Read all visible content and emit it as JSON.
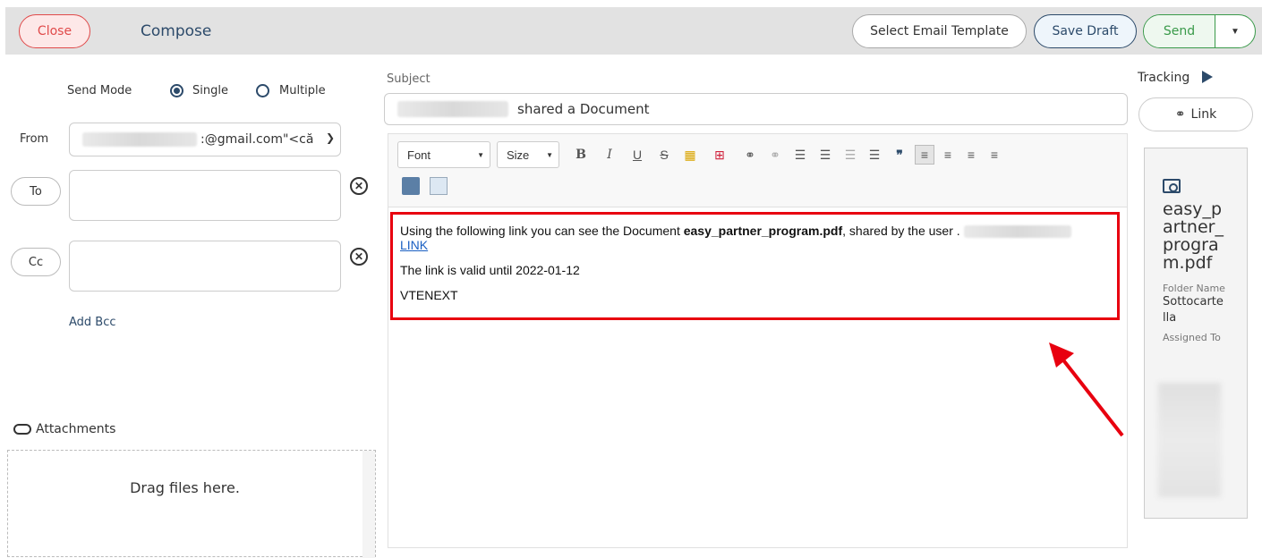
{
  "header": {
    "close_label": "Close",
    "title": "Compose",
    "select_template_label": "Select Email Template",
    "save_draft_label": "Save Draft",
    "send_label": "Send"
  },
  "form": {
    "send_mode_label": "Send Mode",
    "mode_single": "Single",
    "mode_multiple": "Multiple",
    "from_label": "From",
    "from_value": ":@gmail.com\"<că",
    "to_label": "To",
    "cc_label": "Cc",
    "add_bcc": "Add Bcc",
    "attachments_label": "Attachments",
    "drop_text": "Drag files here."
  },
  "subject": {
    "label": "Subject",
    "value": "shared a Document"
  },
  "toolbar": {
    "font": "Font",
    "size": "Size"
  },
  "body": {
    "line1_prefix": "Using the following link you can see the Document",
    "doc_name": "easy_partner_program.pdf",
    "line1_suffix": ", shared by the user .",
    "link_text": "LINK",
    "line2": "The link is valid until 2022-01-12",
    "line3": "VTENEXT"
  },
  "sidebar": {
    "tracking_label": "Tracking",
    "link_label": "Link",
    "doc_title": "easy_partner_program.pdf",
    "folder_name_label": "Folder Name",
    "folder_name_value": "Sottocartella",
    "assigned_to_label": "Assigned To"
  },
  "colors": {
    "accent": "#2c4a6a",
    "highlight_border": "#e8000f",
    "send_green": "#3a9a4a",
    "close_red": "#e04a4a"
  }
}
